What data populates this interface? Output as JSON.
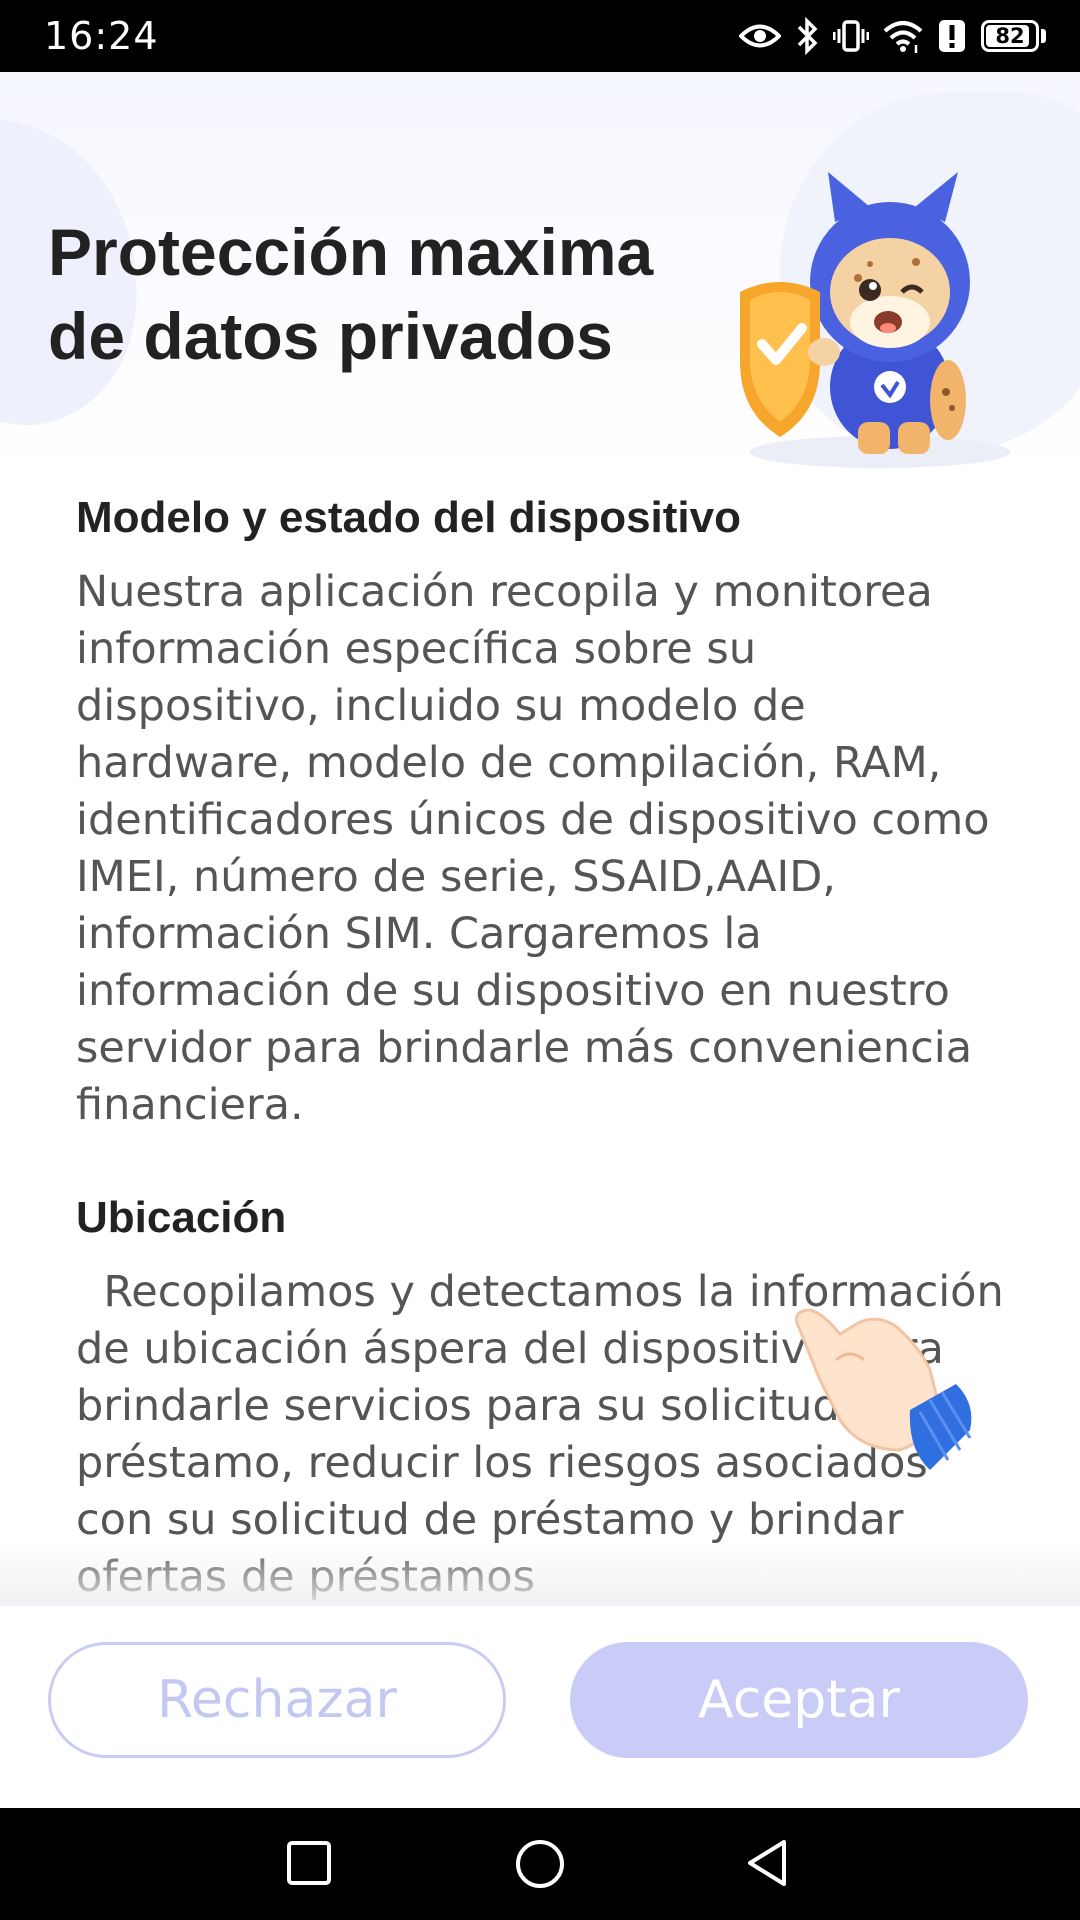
{
  "status_bar": {
    "time": "16:24",
    "icons": [
      "eye-icon",
      "bluetooth-icon",
      "vibrate-icon",
      "wifi-icon",
      "alert-icon",
      "battery-icon"
    ],
    "battery_level": "82"
  },
  "header": {
    "title": "Protección maxima\nde datos privados"
  },
  "sections": [
    {
      "heading": "Modelo y estado del dispositivo",
      "body": "Nuestra aplicación recopila y monitorea información específica sobre su dispositivo, incluido su modelo de hardware, modelo de compilación, RAM, identificadores únicos de dispositivo como IMEI, número de serie, SSAID,AAID, información SIM. Cargaremos la información de su dispositivo en nuestro servidor para brindarle más conveniencia financiera."
    },
    {
      "heading": "Ubicación",
      "body": "  Recopilamos y detectamos la información de ubicación áspera del dispositivo para brindarle servicios para su solicitud de préstamo, reducir los riesgos asociados con su solicitud de préstamo y brindar ofertas de préstamos"
    }
  ],
  "buttons": {
    "reject_label": "Rechazar",
    "accept_label": "Aceptar"
  },
  "nav_bar": {
    "icons": [
      "recent-apps-icon",
      "home-icon",
      "back-icon"
    ]
  },
  "colors": {
    "accent": "#c8ccf7",
    "reject_border": "#c9cdf3",
    "title": "#222222",
    "body": "#555555"
  }
}
